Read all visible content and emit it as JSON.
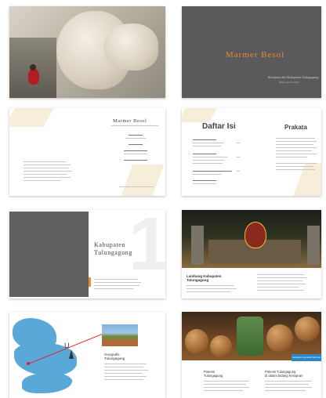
{
  "spread1": {
    "cover_title": "Marmer Besol",
    "cover_subtitle": "Kerajinan dari Kabupaten Tulungagung",
    "cover_author": "Rifki Amrul Fauzi"
  },
  "spread2": {
    "title_page_heading": "Marmer Besol",
    "toc_heading": "Daftar Isi",
    "preface_heading": "Prakata"
  },
  "spread3": {
    "chapter_title_line1": "Kabupaten",
    "chapter_title_line2": "Tulungagung",
    "chapter_number": "1",
    "section_heading_line1": "Lambang Kabupaten",
    "section_heading_line2": "Tulungagung"
  },
  "spread4": {
    "map_north_label": "U",
    "section_heading_line1": "Geografis",
    "section_heading_line2": "Tulungagung",
    "left_heading_line1": "Potensi",
    "left_heading_line2": "Tulungagung",
    "right_heading_line1": "Potensi Tulungagung",
    "right_heading_line2": "di dalam bidang Kerajinan",
    "badge_label": "Kerajinan Gerabah Marmer"
  },
  "colors": {
    "accent": "#e68a2e",
    "dark_gray": "#5a5a5c",
    "map_blue": "#5aa8d8",
    "badge_blue": "#2a86c8"
  }
}
